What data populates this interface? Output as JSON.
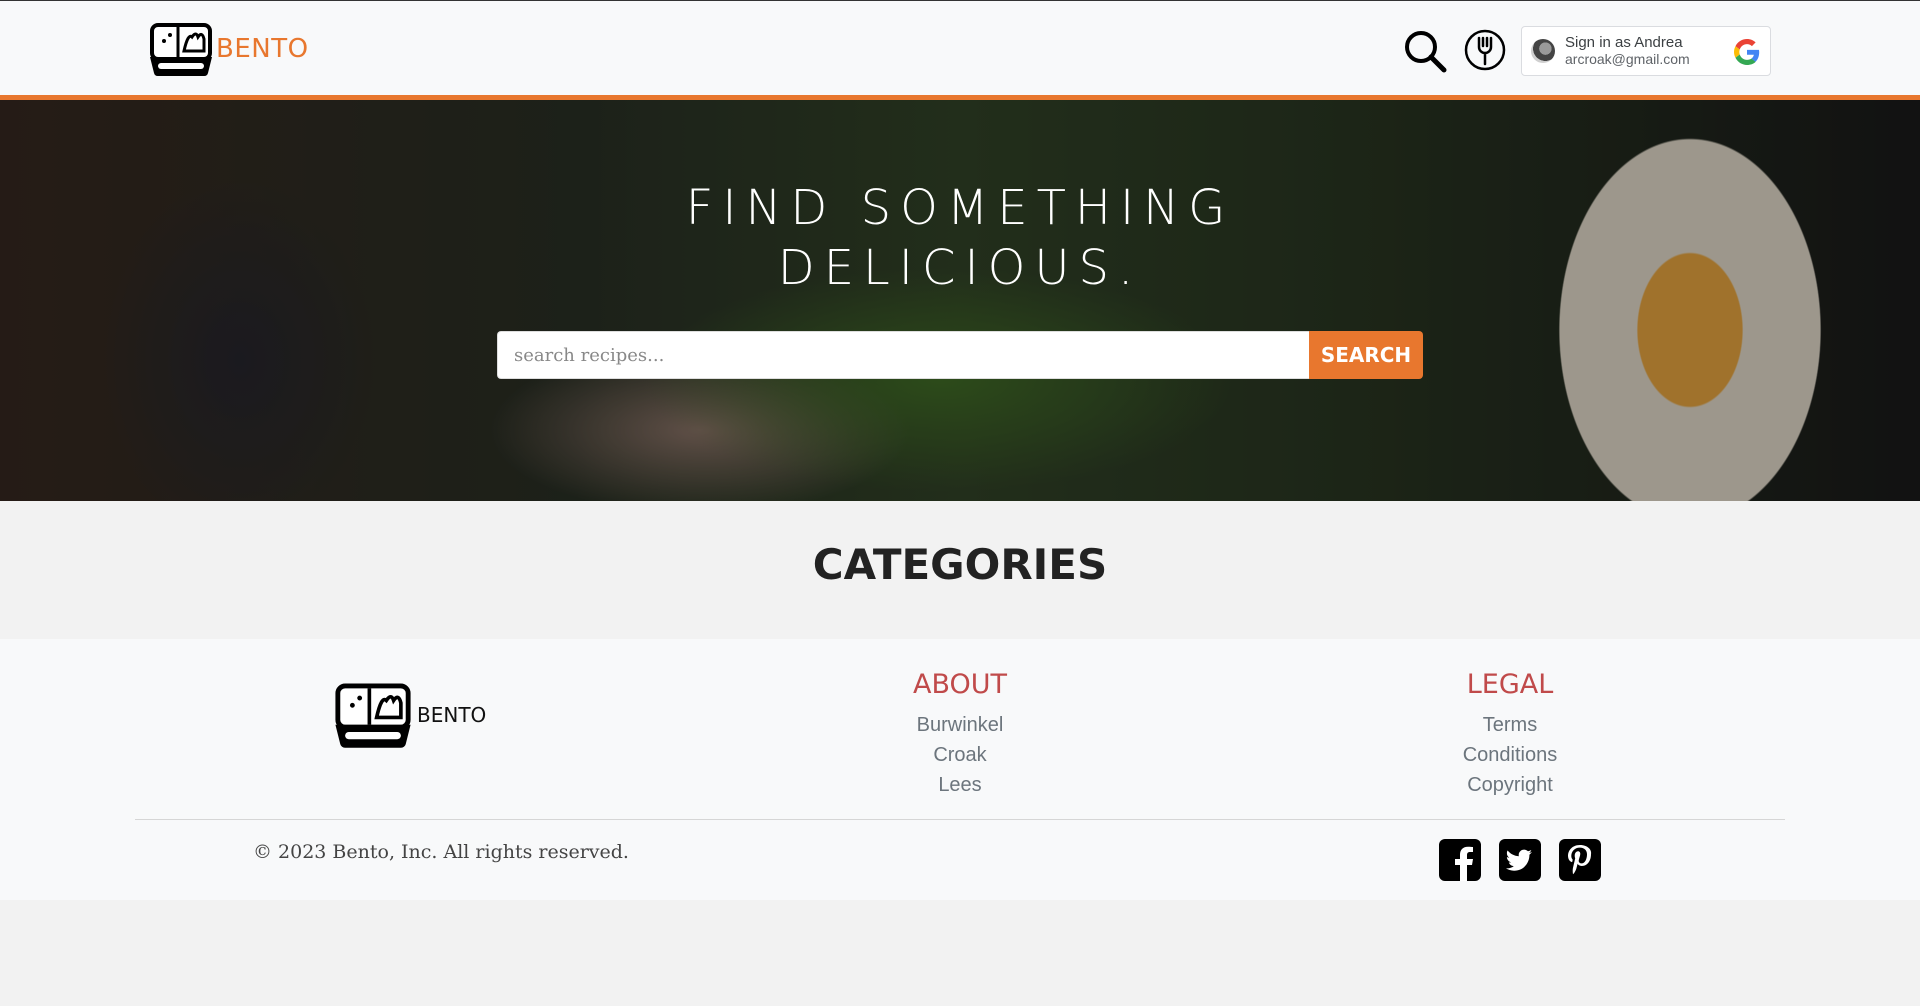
{
  "navbar": {
    "brand": "BENTO",
    "google_signin": {
      "name": "Sign in as Andrea",
      "email": "arcroak@gmail.com"
    }
  },
  "hero": {
    "title": "FIND SOMETHING DELICIOUS.",
    "search_placeholder": "search recipes...",
    "search_button": "SEARCH"
  },
  "categories": {
    "heading": "CATEGORIES"
  },
  "footer": {
    "brand": "BENTO",
    "about": {
      "heading": "ABOUT",
      "links": [
        "Burwinkel",
        "Croak",
        "Lees"
      ]
    },
    "legal": {
      "heading": "LEGAL",
      "links": [
        "Terms",
        "Conditions",
        "Copyright"
      ]
    },
    "copyright": "© 2023 Bento, Inc. All rights reserved."
  },
  "colors": {
    "accent": "#e8772e",
    "footer_heading": "#c04a4a"
  },
  "icons": [
    "bento-logo-icon",
    "search-icon",
    "fork-icon",
    "google-icon",
    "facebook-icon",
    "twitter-icon",
    "pinterest-icon"
  ]
}
